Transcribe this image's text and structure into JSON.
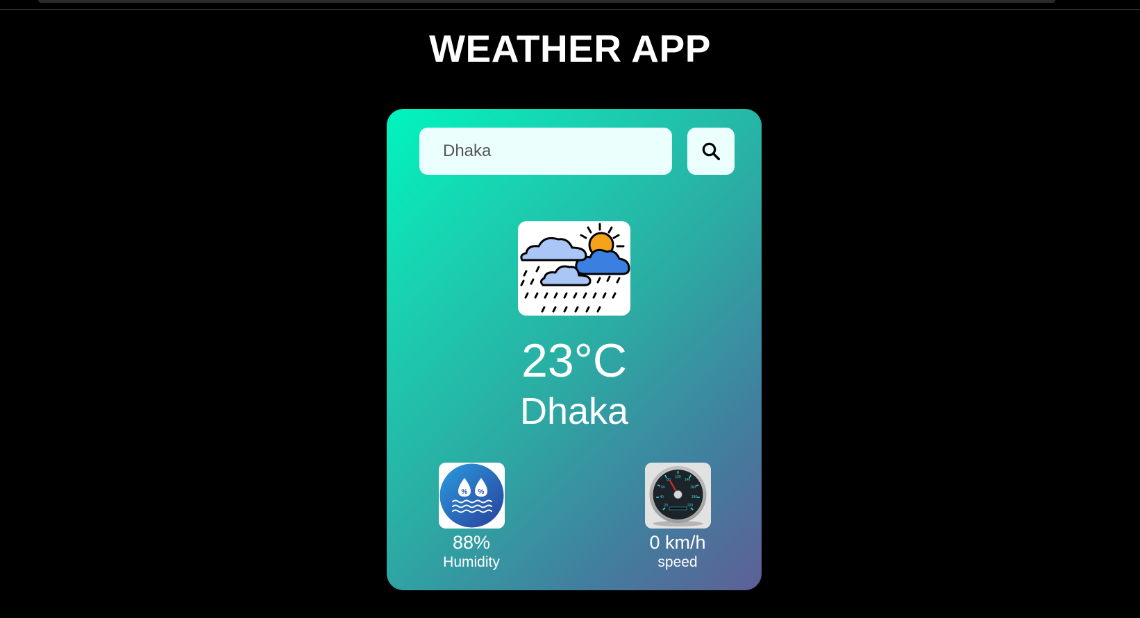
{
  "app": {
    "title": "WEATHER APP"
  },
  "search": {
    "value": "Dhaka",
    "button_icon": "search-icon"
  },
  "weather": {
    "icon": "cloud-sun-rain-icon",
    "temperature": "23°C",
    "city": "Dhaka"
  },
  "details": {
    "humidity": {
      "icon": "humidity-icon",
      "value": "88%",
      "label": "Humidity"
    },
    "wind": {
      "icon": "speedometer-icon",
      "value": "0 km/h",
      "label": "speed"
    }
  },
  "colors": {
    "background": "#000000",
    "card_gradient_start": "#00f5be",
    "card_gradient_end": "#5e5f96",
    "input_background": "#ebfffc",
    "text": "#ffffff"
  }
}
